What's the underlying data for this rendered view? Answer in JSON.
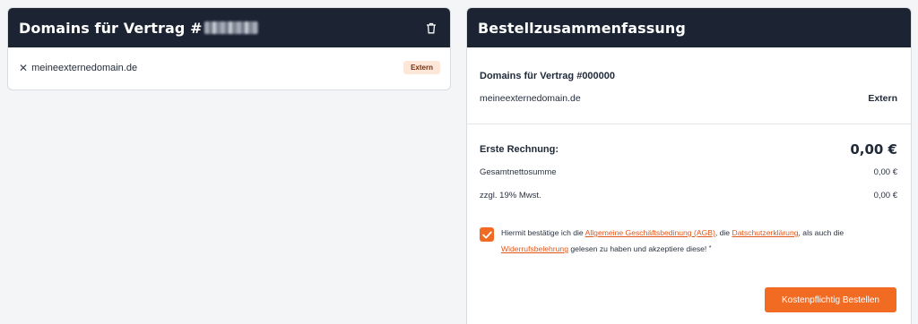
{
  "left": {
    "title": "Domains für Vertrag #",
    "domain": "meineexternedomain.de",
    "badge": "Extern"
  },
  "summary": {
    "title": "Bestellzusammenfassung",
    "contract_title": "Domains für Vertrag #000000",
    "domain": "meineexternedomain.de",
    "domain_type": "Extern",
    "first_invoice_label": "Erste Rechnung:",
    "first_invoice_value": "0,00 €",
    "net_label": "Gesamtnettosumme",
    "net_value": "0,00 €",
    "vat_label": "zzgl. 19% Mwst.",
    "vat_value": "0,00 €"
  },
  "consent": {
    "prefix": "Hiermit bestätige ich die ",
    "link_agb": "Allgemeine Geschäftsbedinung (AGB)",
    "sep1": ", die ",
    "link_privacy": "Datschutzerklärung",
    "sep2": ", als auch die ",
    "link_withdrawal": "Widerrufsbelehrung",
    "suffix": " gelesen zu haben und akzeptiere diese! ",
    "required_mark": "*",
    "checked": true
  },
  "order_button": "Kostenpflichtig Bestellen",
  "colors": {
    "header_bg": "#1c2333",
    "accent": "#f26b22",
    "link": "#e2571b",
    "badge_bg": "#fde7d9"
  }
}
